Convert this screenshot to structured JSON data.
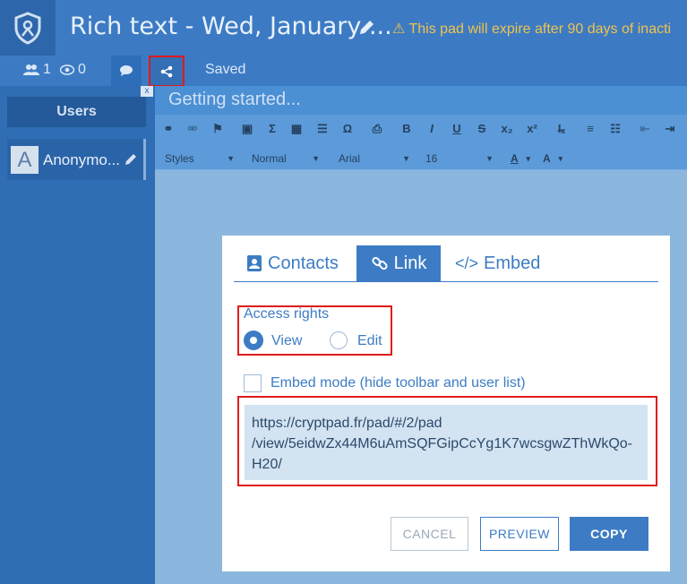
{
  "header": {
    "title": "Rich text - Wed, January ...",
    "warning": "This pad will expire after 90 days of inacti"
  },
  "toolbar": {
    "users_count": "1",
    "viewers_count": "0",
    "saved_label": "Saved"
  },
  "sidebar": {
    "users_header": "Users",
    "close_label": "x",
    "user": {
      "avatar_letter": "A",
      "name": "Anonymo..."
    }
  },
  "editor": {
    "pad_title": "Getting started...",
    "combos": {
      "styles": "Styles",
      "format": "Normal",
      "font": "Arial",
      "size": "16"
    },
    "buttons": {
      "bold": "B",
      "italic": "I",
      "underline": "U",
      "strike": "S",
      "subscript": "x₂",
      "superscript": "x²",
      "text_color": "A",
      "bg_color": "A",
      "special_char": "Ω",
      "formula": "Σ"
    }
  },
  "share_dialog": {
    "tabs": {
      "contacts": "Contacts",
      "link": "Link",
      "embed": "Embed"
    },
    "access_rights_label": "Access rights",
    "view_label": "View",
    "edit_label": "Edit",
    "selected_right": "View",
    "embed_mode_label": "Embed mode (hide toolbar and user list)",
    "embed_mode_checked": false,
    "link_url": "https://cryptpad.fr/pad/#/2/pad/view/5eidwZx44M6uAmSQFGipCcYg1K7wcsgwZThWkQo-H20/",
    "link_line1": "https://cryptpad.fr/pad/#/2/pad",
    "link_line2": "/view/5eidwZx44M6uAmSQFGipCcYg1K7wcsgwZThWkQo-",
    "link_line3": "H20/",
    "cancel_label": "CANCEL",
    "preview_label": "PREVIEW",
    "copy_label": "COPY"
  },
  "colors": {
    "accent": "#3d7cc4",
    "highlight_red": "#e01b1b",
    "warning": "#f0c24c"
  }
}
